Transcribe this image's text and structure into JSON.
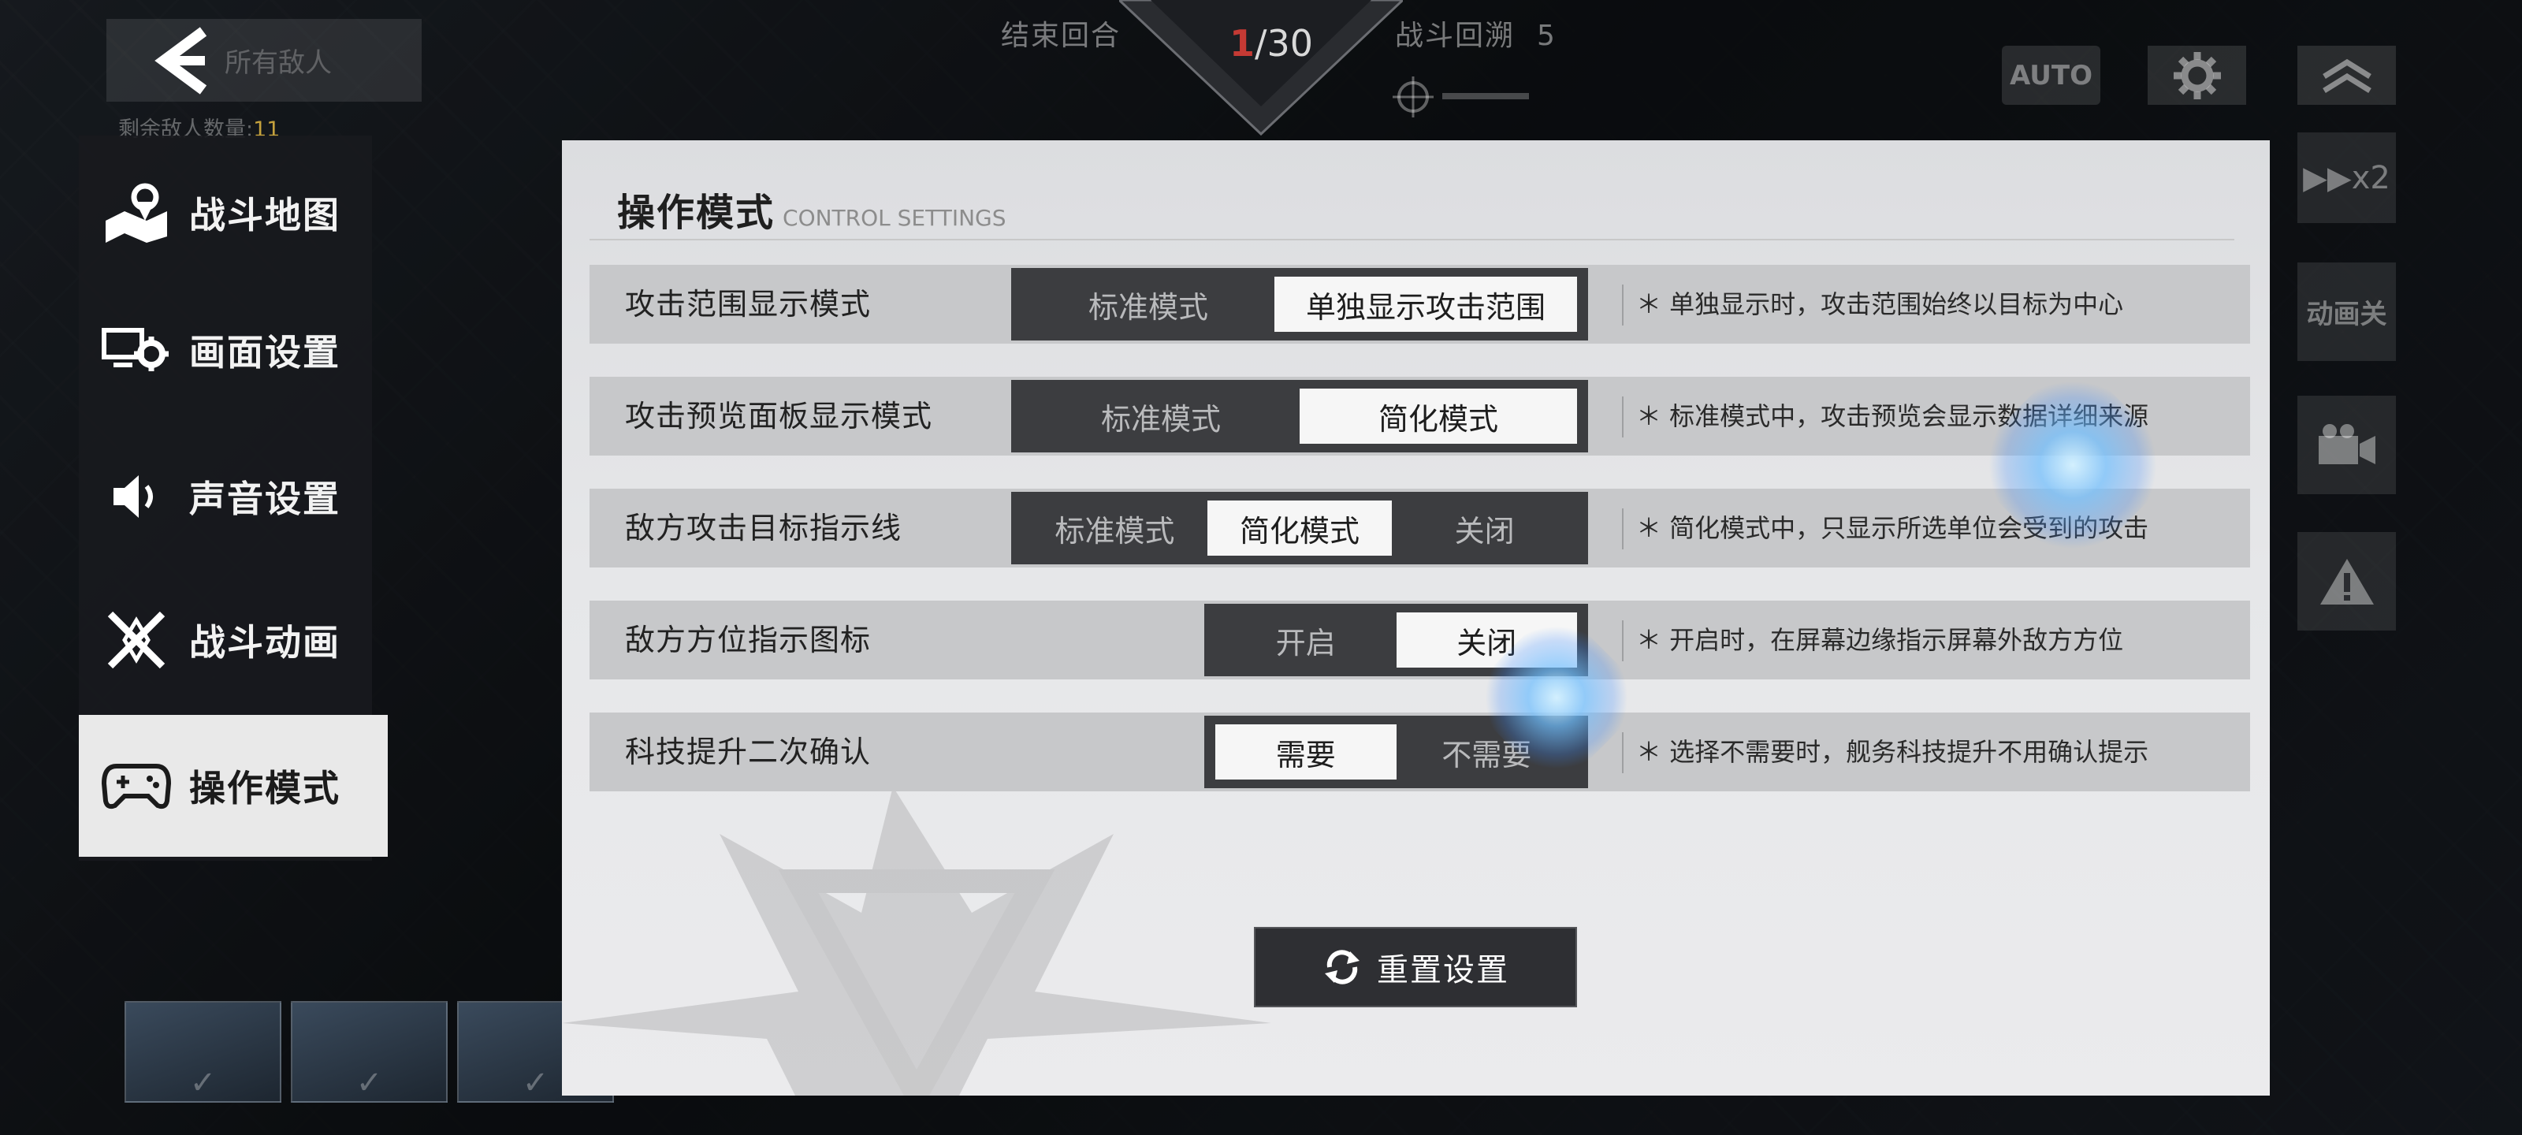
{
  "hud": {
    "back_ghost_text": "所有敌人",
    "enemy_count_label": "剩余敌人数量:",
    "enemy_count_value": "11",
    "end_turn": "结束回合",
    "round_current": "1",
    "round_total": "/30",
    "battle_rewind": "战斗回溯",
    "rewind_count": "5",
    "auto_label": "AUTO",
    "speed_label": "▶▶x2",
    "anim_label": "动画关"
  },
  "menu": {
    "items": [
      {
        "label": "战斗地图",
        "icon": "map-icon"
      },
      {
        "label": "画面设置",
        "icon": "display-settings-icon"
      },
      {
        "label": "声音设置",
        "icon": "speaker-icon"
      },
      {
        "label": "战斗动画",
        "icon": "battle-animation-icon"
      },
      {
        "label": "操作模式",
        "icon": "gamepad-icon",
        "active": true
      }
    ]
  },
  "panel": {
    "title": "操作模式",
    "subtitle": "CONTROL SETTINGS",
    "rows": [
      {
        "label": "攻击范围显示模式",
        "options": [
          "标准模式",
          "单独显示攻击范围"
        ],
        "selected": 1,
        "note": "＊ 单独显示时，攻击范围始终以目标为中心"
      },
      {
        "label": "攻击预览面板显示模式",
        "options": [
          "标准模式",
          "简化模式"
        ],
        "selected": 1,
        "note": "＊ 标准模式中，攻击预览会显示数据详细来源"
      },
      {
        "label": "敌方攻击目标指示线",
        "options": [
          "标准模式",
          "简化模式",
          "关闭"
        ],
        "selected": 1,
        "note": "＊ 简化模式中，只显示所选单位会受到的攻击"
      },
      {
        "label": "敌方方位指示图标",
        "options": [
          "开启",
          "关闭"
        ],
        "selected": 1,
        "note": "＊ 开启时，在屏幕边缘指示屏幕外敌方方位"
      },
      {
        "label": "科技提升二次确认",
        "options": [
          "需要",
          "不需要"
        ],
        "selected": 0,
        "note": "＊ 选择不需要时，舰务科技提升不用确认提示"
      }
    ],
    "reset_label": "重置设置"
  },
  "colors": {
    "panel_bg": "#e6e7e9",
    "row_bg": "#c7c8ca",
    "segment_bg": "#3c3d40",
    "selected_bg": "#f6f6f6",
    "round_accent": "#c53a34",
    "enemy_count_color": "#c5a23d"
  }
}
